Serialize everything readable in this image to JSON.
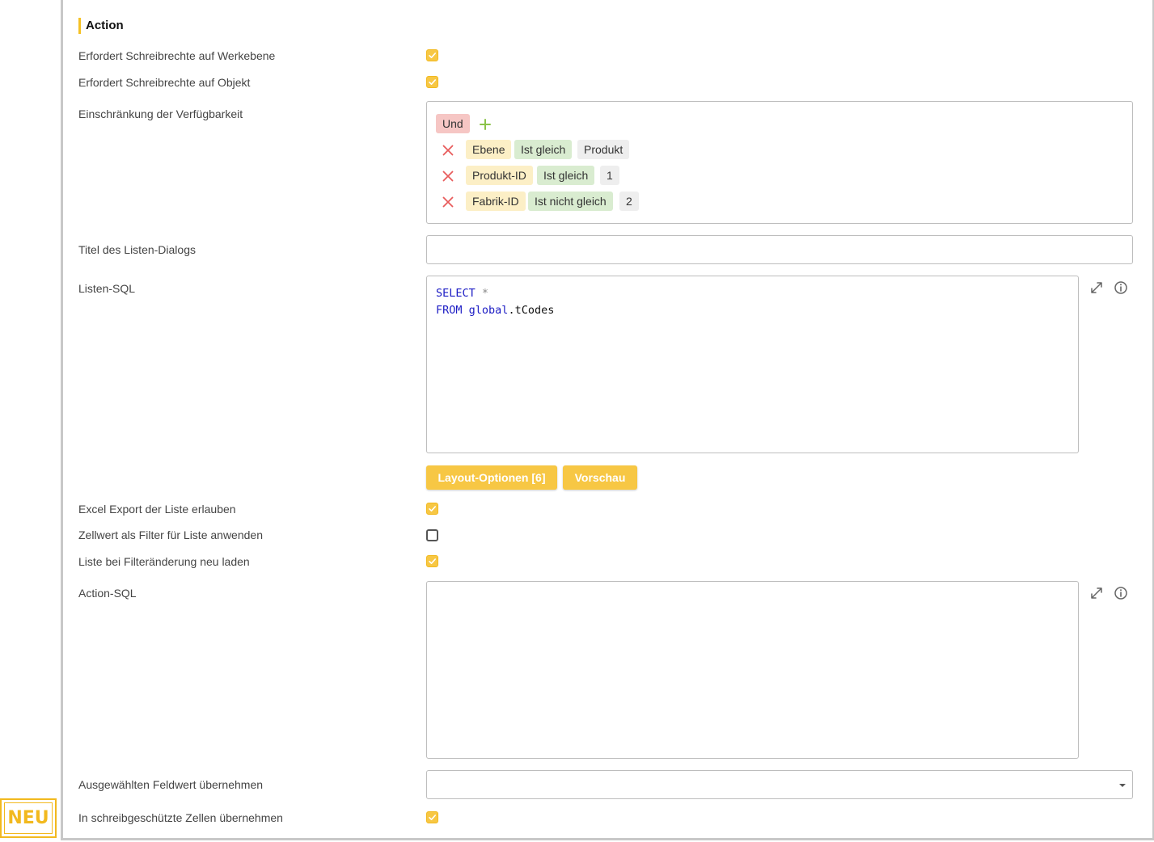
{
  "section": {
    "title": "Action"
  },
  "fields": {
    "write_plant": {
      "label": "Erfordert Schreibrechte auf Werkebene",
      "checked": true
    },
    "write_object": {
      "label": "Erfordert Schreibrechte auf Objekt",
      "checked": true
    },
    "availability": {
      "label": "Einschränkung der Verfügbarkeit",
      "operator": "Und",
      "conditions": [
        {
          "field": "Ebene",
          "op": "Ist gleich",
          "value": "Produkt"
        },
        {
          "field": "Produkt-ID",
          "op": "Ist gleich",
          "value": "1"
        },
        {
          "field": "Fabrik-ID",
          "op": "Ist nicht gleich",
          "value": "2"
        }
      ]
    },
    "list_dialog_title": {
      "label": "Titel des Listen-Dialogs",
      "value": ""
    },
    "list_sql": {
      "label": "Listen-SQL",
      "line1_kw": "SELECT",
      "line1_rest": "*",
      "line2_kw": "FROM",
      "line2_schema": "global",
      "line2_rest": ".tCodes"
    },
    "buttons": {
      "layout": "Layout-Optionen [6]",
      "preview": "Vorschau"
    },
    "excel_export": {
      "label": "Excel Export der Liste erlauben",
      "checked": true
    },
    "cell_filter": {
      "label": "Zellwert als Filter für Liste anwenden",
      "checked": false
    },
    "reload_filter": {
      "label": "Liste bei Filteränderung neu laden",
      "checked": true
    },
    "action_sql": {
      "label": "Action-SQL",
      "value": ""
    },
    "apply_field": {
      "label": "Ausgewählten Feldwert übernehmen",
      "value": ""
    },
    "readonly_cells": {
      "label": "In schreibgeschützte Zellen übernehmen",
      "checked": true
    }
  },
  "badge": {
    "text": "NEU"
  },
  "colors": {
    "accent": "#f7c744",
    "and_chip": "#f6c6c4",
    "field_chip": "#fcefc6",
    "op_chip": "#d9ecd0",
    "value_chip": "#eeeeee",
    "delete": "#e85c5c",
    "add": "#8bc34a"
  },
  "icons": [
    "check-icon",
    "close-icon",
    "plus-icon",
    "expand-icon",
    "info-icon",
    "caret-down-icon"
  ]
}
